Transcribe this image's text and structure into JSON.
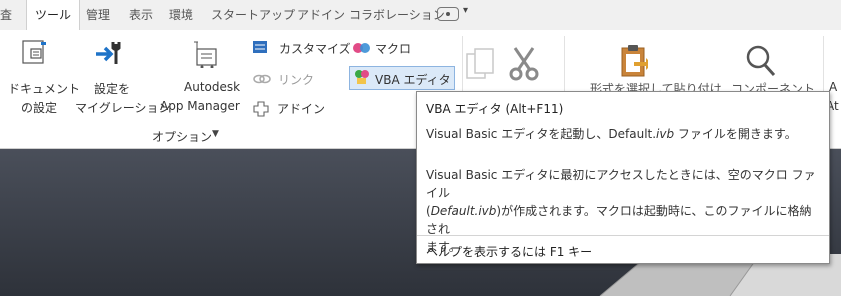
{
  "tabs": [
    {
      "label": "査"
    },
    {
      "label": "ツール",
      "active": true
    },
    {
      "label": "管理"
    },
    {
      "label": "表示"
    },
    {
      "label": "環境"
    },
    {
      "label": "スタートアップ"
    },
    {
      "label": "アドイン"
    },
    {
      "label": "コラボレーション"
    }
  ],
  "tab_extra": {
    "dropdown_caret": "▾"
  },
  "ribbon": {
    "doc_settings": {
      "line1": "ドキュメント",
      "line2": "の設定",
      "icon": "document-settings-icon"
    },
    "migrate": {
      "line1": "設定を",
      "line2": "マイグレーション",
      "icon": "migrate-icon"
    },
    "app_manager": {
      "line1": "Autodesk",
      "line2": "App Manager",
      "icon": "app-manager-icon"
    },
    "customize": {
      "label": "カスタマイズ",
      "icon": "customize-icon"
    },
    "link": {
      "label": "リンク",
      "icon": "link-icon"
    },
    "addin": {
      "label": "アドイン",
      "icon": "addin-icon"
    },
    "macro": {
      "label": "マクロ",
      "icon": "macro-icon"
    },
    "vba_editor": {
      "label": "VBA エディタ",
      "icon": "vba-editor-icon"
    },
    "options_panel": {
      "label": "オプション",
      "caret": "▼"
    },
    "select_paste": {
      "partial_label": "形式を選択して貼り付け",
      "icon": "clipboard-icon"
    },
    "component": {
      "partial_label": "コンポーネント",
      "icon": "find-icon"
    },
    "right_edge": {
      "line1": "A",
      "line2": "At"
    },
    "copy": {
      "icon": "copy-icon"
    },
    "cut": {
      "icon": "cut-icon"
    }
  },
  "tooltip": {
    "title": "VBA エディタ (Alt+F11)",
    "description_prefix": "Visual Basic エディタを起動し、Default.",
    "description_ext": "ivb",
    "description_suffix": " ファイルを開きます。",
    "detail_line1": "Visual Basic エディタに最初にアクセスしたときには、空のマクロ ファイル",
    "detail_line2_open": "(",
    "detail_line2_file": "Default.ivb",
    "detail_line2_rest": ")が作成されます。マクロは起動時に、このファイルに格納され",
    "detail_line3": "ます。",
    "help": "ヘルプを表示するには F1 キー"
  },
  "colors": {
    "accent_blue": "#1e73c8",
    "tool_grey": "#6b6b6b",
    "viewport": "#3a3f48"
  }
}
